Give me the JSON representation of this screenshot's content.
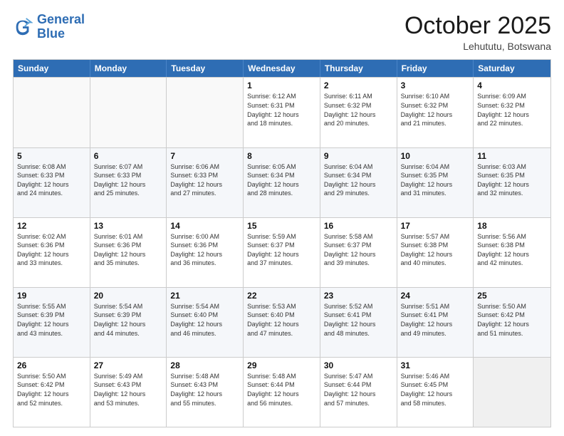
{
  "logo": {
    "line1": "General",
    "line2": "Blue"
  },
  "header": {
    "month": "October 2025",
    "location": "Lehututu, Botswana"
  },
  "weekdays": [
    "Sunday",
    "Monday",
    "Tuesday",
    "Wednesday",
    "Thursday",
    "Friday",
    "Saturday"
  ],
  "rows": [
    [
      {
        "day": "",
        "info": ""
      },
      {
        "day": "",
        "info": ""
      },
      {
        "day": "",
        "info": ""
      },
      {
        "day": "1",
        "info": "Sunrise: 6:12 AM\nSunset: 6:31 PM\nDaylight: 12 hours\nand 18 minutes."
      },
      {
        "day": "2",
        "info": "Sunrise: 6:11 AM\nSunset: 6:32 PM\nDaylight: 12 hours\nand 20 minutes."
      },
      {
        "day": "3",
        "info": "Sunrise: 6:10 AM\nSunset: 6:32 PM\nDaylight: 12 hours\nand 21 minutes."
      },
      {
        "day": "4",
        "info": "Sunrise: 6:09 AM\nSunset: 6:32 PM\nDaylight: 12 hours\nand 22 minutes."
      }
    ],
    [
      {
        "day": "5",
        "info": "Sunrise: 6:08 AM\nSunset: 6:33 PM\nDaylight: 12 hours\nand 24 minutes."
      },
      {
        "day": "6",
        "info": "Sunrise: 6:07 AM\nSunset: 6:33 PM\nDaylight: 12 hours\nand 25 minutes."
      },
      {
        "day": "7",
        "info": "Sunrise: 6:06 AM\nSunset: 6:33 PM\nDaylight: 12 hours\nand 27 minutes."
      },
      {
        "day": "8",
        "info": "Sunrise: 6:05 AM\nSunset: 6:34 PM\nDaylight: 12 hours\nand 28 minutes."
      },
      {
        "day": "9",
        "info": "Sunrise: 6:04 AM\nSunset: 6:34 PM\nDaylight: 12 hours\nand 29 minutes."
      },
      {
        "day": "10",
        "info": "Sunrise: 6:04 AM\nSunset: 6:35 PM\nDaylight: 12 hours\nand 31 minutes."
      },
      {
        "day": "11",
        "info": "Sunrise: 6:03 AM\nSunset: 6:35 PM\nDaylight: 12 hours\nand 32 minutes."
      }
    ],
    [
      {
        "day": "12",
        "info": "Sunrise: 6:02 AM\nSunset: 6:36 PM\nDaylight: 12 hours\nand 33 minutes."
      },
      {
        "day": "13",
        "info": "Sunrise: 6:01 AM\nSunset: 6:36 PM\nDaylight: 12 hours\nand 35 minutes."
      },
      {
        "day": "14",
        "info": "Sunrise: 6:00 AM\nSunset: 6:36 PM\nDaylight: 12 hours\nand 36 minutes."
      },
      {
        "day": "15",
        "info": "Sunrise: 5:59 AM\nSunset: 6:37 PM\nDaylight: 12 hours\nand 37 minutes."
      },
      {
        "day": "16",
        "info": "Sunrise: 5:58 AM\nSunset: 6:37 PM\nDaylight: 12 hours\nand 39 minutes."
      },
      {
        "day": "17",
        "info": "Sunrise: 5:57 AM\nSunset: 6:38 PM\nDaylight: 12 hours\nand 40 minutes."
      },
      {
        "day": "18",
        "info": "Sunrise: 5:56 AM\nSunset: 6:38 PM\nDaylight: 12 hours\nand 42 minutes."
      }
    ],
    [
      {
        "day": "19",
        "info": "Sunrise: 5:55 AM\nSunset: 6:39 PM\nDaylight: 12 hours\nand 43 minutes."
      },
      {
        "day": "20",
        "info": "Sunrise: 5:54 AM\nSunset: 6:39 PM\nDaylight: 12 hours\nand 44 minutes."
      },
      {
        "day": "21",
        "info": "Sunrise: 5:54 AM\nSunset: 6:40 PM\nDaylight: 12 hours\nand 46 minutes."
      },
      {
        "day": "22",
        "info": "Sunrise: 5:53 AM\nSunset: 6:40 PM\nDaylight: 12 hours\nand 47 minutes."
      },
      {
        "day": "23",
        "info": "Sunrise: 5:52 AM\nSunset: 6:41 PM\nDaylight: 12 hours\nand 48 minutes."
      },
      {
        "day": "24",
        "info": "Sunrise: 5:51 AM\nSunset: 6:41 PM\nDaylight: 12 hours\nand 49 minutes."
      },
      {
        "day": "25",
        "info": "Sunrise: 5:50 AM\nSunset: 6:42 PM\nDaylight: 12 hours\nand 51 minutes."
      }
    ],
    [
      {
        "day": "26",
        "info": "Sunrise: 5:50 AM\nSunset: 6:42 PM\nDaylight: 12 hours\nand 52 minutes."
      },
      {
        "day": "27",
        "info": "Sunrise: 5:49 AM\nSunset: 6:43 PM\nDaylight: 12 hours\nand 53 minutes."
      },
      {
        "day": "28",
        "info": "Sunrise: 5:48 AM\nSunset: 6:43 PM\nDaylight: 12 hours\nand 55 minutes."
      },
      {
        "day": "29",
        "info": "Sunrise: 5:48 AM\nSunset: 6:44 PM\nDaylight: 12 hours\nand 56 minutes."
      },
      {
        "day": "30",
        "info": "Sunrise: 5:47 AM\nSunset: 6:44 PM\nDaylight: 12 hours\nand 57 minutes."
      },
      {
        "day": "31",
        "info": "Sunrise: 5:46 AM\nSunset: 6:45 PM\nDaylight: 12 hours\nand 58 minutes."
      },
      {
        "day": "",
        "info": ""
      }
    ]
  ]
}
